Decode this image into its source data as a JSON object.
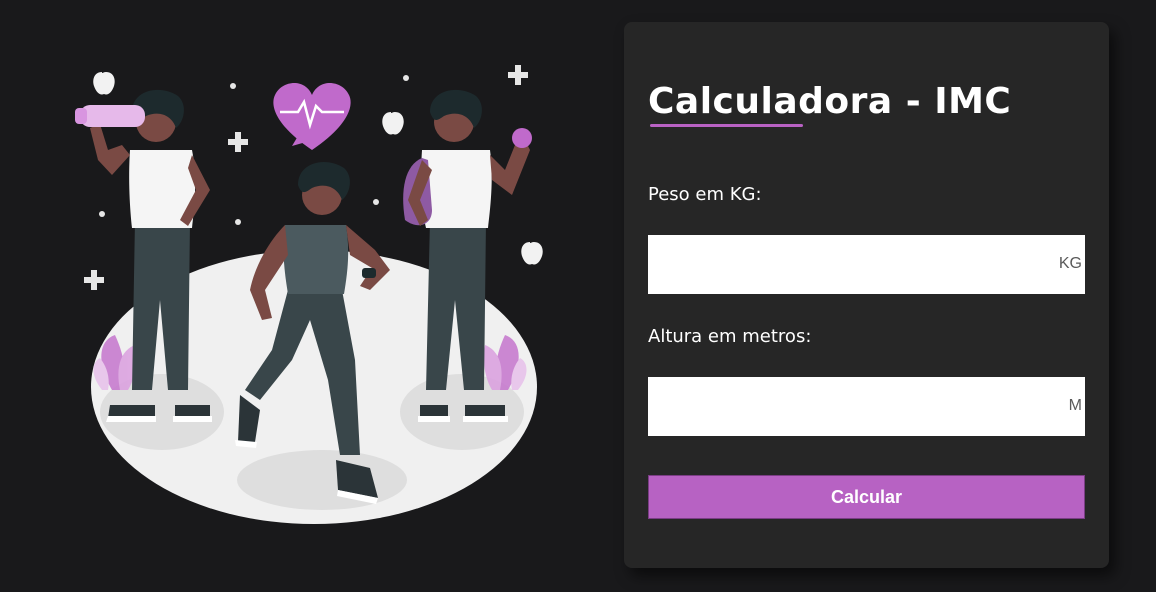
{
  "header": {
    "title": "Calculadora - IMC"
  },
  "form": {
    "weight": {
      "label": "Peso em KG:",
      "value": "",
      "unit": "KG"
    },
    "height": {
      "label": "Altura em metros:",
      "value": "",
      "unit": "M"
    },
    "submit_label": "Calcular"
  },
  "colors": {
    "background": "#19191b",
    "card": "#262626",
    "accent": "#b762c3",
    "text": "#ffffff"
  },
  "illustration": {
    "icon": "fitness-people-illustration"
  }
}
